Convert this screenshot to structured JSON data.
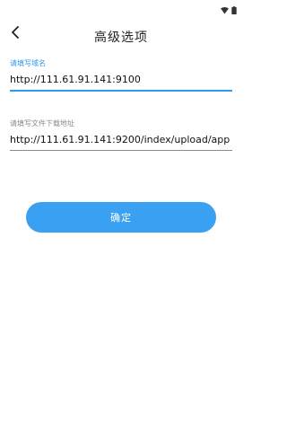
{
  "header": {
    "title": "高级选项",
    "back_icon": "chevron-left-icon"
  },
  "status_bar": {
    "icons": [
      "wifi-icon",
      "battery-icon"
    ]
  },
  "form": {
    "domain_field": {
      "label": "请填写域名",
      "value": "http://111.61.91.141:9100",
      "focused": true
    },
    "download_field": {
      "label": "请填写文件下载地址",
      "value": "http://111.61.91.141:9200/index/upload/app",
      "focused": false
    },
    "confirm_label": "确定"
  },
  "colors": {
    "accent": "#2e9af0",
    "button": "#3aa0f2",
    "text": "#111111",
    "hint": "#8a8a8a"
  }
}
